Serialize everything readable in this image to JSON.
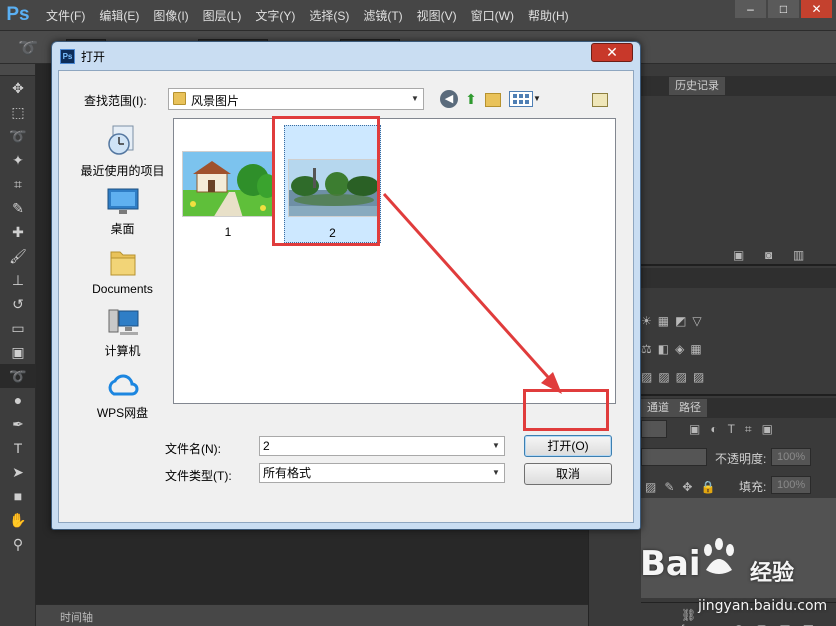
{
  "app": {
    "logo": "Ps",
    "menu": [
      "文件(F)",
      "编辑(E)",
      "图像(I)",
      "图层(L)",
      "文字(Y)",
      "选择(S)",
      "滤镜(T)",
      "视图(V)",
      "窗口(W)",
      "帮助(H)"
    ],
    "window_buttons": {
      "minimize": "–",
      "maximize": "□",
      "close": "✕"
    },
    "timeline_label": "时间轴"
  },
  "panels": {
    "history_tab": "历史记录",
    "channels_tab": "通道",
    "paths_tab": "路径",
    "opacity_label": "不透明度:",
    "opacity_value": "100%",
    "fill_label": "填充:",
    "fill_value": "100%"
  },
  "dialog": {
    "title": "打开",
    "close_glyph": "✕",
    "lookin_label": "查找范围(I):",
    "lookin_value": "风景图片",
    "places": [
      {
        "label": "最近使用的项目",
        "icon": "recent-items-icon"
      },
      {
        "label": "桌面",
        "icon": "desktop-icon"
      },
      {
        "label": "Documents",
        "icon": "documents-folder-icon"
      },
      {
        "label": "计算机",
        "icon": "computer-icon"
      },
      {
        "label": "WPS网盘",
        "icon": "cloud-icon"
      }
    ],
    "files": [
      {
        "name": "1",
        "selected": false
      },
      {
        "name": "2",
        "selected": true
      }
    ],
    "filename_label": "文件名(N):",
    "filename_value": "2",
    "filetype_label": "文件类型(T):",
    "filetype_value": "所有格式",
    "open_button": "打开(O)",
    "cancel_button": "取消"
  },
  "annotation": {
    "color": "#e03c3c"
  },
  "watermark": {
    "brand": "Bai",
    "suffix": "经验",
    "url": "jingyan.baidu.com"
  }
}
